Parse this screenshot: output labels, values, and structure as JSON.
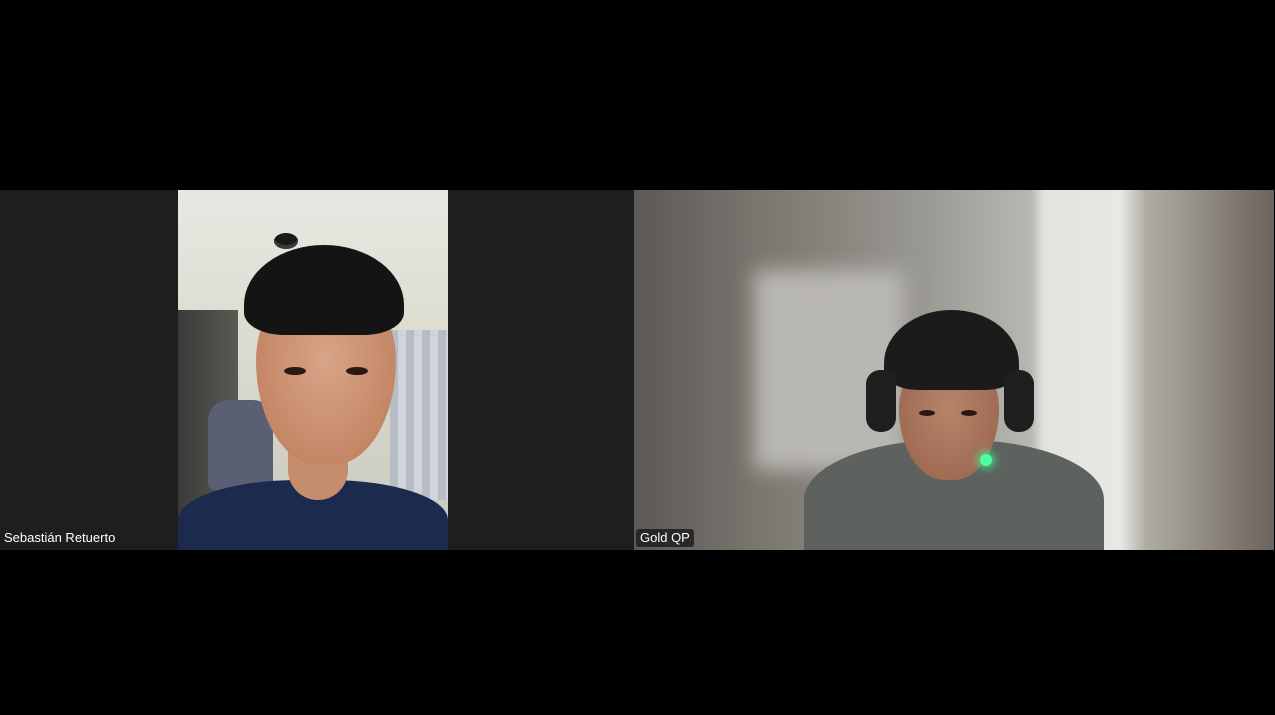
{
  "participants": [
    {
      "name": "Sebastián Retuerto",
      "video": "camera-feed"
    },
    {
      "name": "Gold QP",
      "video": "camera-feed",
      "indicator_color": "#4dff9e"
    }
  ],
  "colors": {
    "background": "#000000",
    "tile_background": "#1e1e1e",
    "label_background": "#1e1e1e",
    "label_text": "#ffffff"
  }
}
